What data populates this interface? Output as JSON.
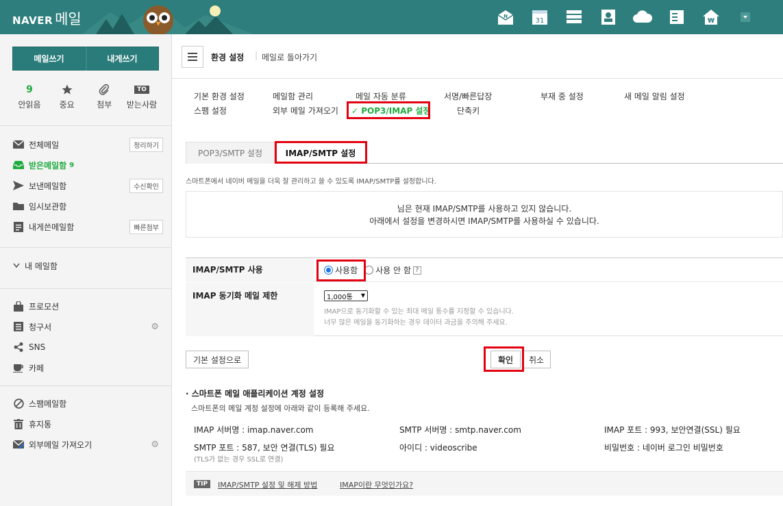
{
  "header": {
    "brand": "NAVER",
    "product": "메일",
    "icons": [
      {
        "name": "mail-envelope-icon",
        "label": "N"
      },
      {
        "name": "calendar-icon",
        "label": "31"
      },
      {
        "name": "list-icon",
        "label": ""
      },
      {
        "name": "contacts-icon",
        "label": ""
      },
      {
        "name": "cloud-icon",
        "label": ""
      },
      {
        "name": "memo-icon",
        "label": ""
      },
      {
        "name": "household-account-icon",
        "label": "₩"
      },
      {
        "name": "more-dropdown-icon",
        "label": "▾"
      }
    ]
  },
  "sidebar": {
    "write_btn": "메일쓰기",
    "self_btn": "내게쓰기",
    "quick": [
      {
        "count": "9",
        "label": "안읽음"
      },
      {
        "label": "중요"
      },
      {
        "label": "첨부"
      },
      {
        "badge": "TO",
        "label": "받는사람"
      }
    ],
    "mailboxes": [
      {
        "label": "전체메일",
        "action": "정리하기"
      },
      {
        "label": "받은메일함",
        "count": "9"
      },
      {
        "label": "보낸메일함",
        "action": "수신확인"
      },
      {
        "label": "임시보관함"
      },
      {
        "label": "내게쓴메일함",
        "action": "빠른첨부"
      }
    ],
    "my_mailbox": "내 메일함",
    "categories": [
      "프로모션",
      "청구서",
      "SNS",
      "카페"
    ],
    "system": [
      "스팸메일함",
      "휴지통",
      "외부메일 가져오기"
    ]
  },
  "topbar": {
    "title": "환경 설정",
    "back": "메일로 돌아가기"
  },
  "settings_nav": [
    "기본 환경 설정",
    "메일함 관리",
    "메일 자동 분류",
    "서명/빠른답장",
    "부재 중 설정",
    "새 메일 알림 설정",
    "스팸 설정",
    "외부 메일 가져오기",
    "✓ POP3/IMAP 설정",
    "단축키"
  ],
  "tabs": {
    "pop3": "POP3/SMTP 설정",
    "imap": "IMAP/SMTP 설정"
  },
  "description": "스마트폰에서 네이버 메일을 더욱 잘 관리하고 쓸 수 있도록 IMAP/SMTP를 설정합니다.",
  "notice": {
    "line1": "님은 현재 IMAP/SMTP를 사용하고 있지 않습니다.",
    "line2": "아래에서 설정을 변경하시면 IMAP/SMTP를 사용하실 수 있습니다."
  },
  "form": {
    "use_label": "IMAP/SMTP 사용",
    "use_on": "사용함",
    "use_off": "사용 안 함",
    "help": "?",
    "sync_label": "IMAP 동기화 메일 제한",
    "sync_value": "1,000통",
    "sync_help1": "IMAP으로 동기화할 수 있는 최대 메일 통수를 지정할 수 있습니다.",
    "sync_help2": "너무 많은 메일을 동기화하는 경우 데이터 과금을 주의해 주세요."
  },
  "buttons": {
    "reset": "기본 설정으로",
    "confirm": "확인",
    "cancel": "취소"
  },
  "smartphone": {
    "title": "· 스마트폰 메일 애플리케이션 계정 설정",
    "subtitle": "스마트폰의 메일 계정 설정에 아래와 같이 등록해 주세요.",
    "imap_server": "IMAP 서버명 : imap.naver.com",
    "smtp_server": "SMTP 서버명 : smtp.naver.com",
    "imap_port": "IMAP 포트 : 993, 보안연결(SSL) 필요",
    "smtp_port": "SMTP 포트 : 587, 보안 연결(TLS) 필요",
    "smtp_port_note": "(TLS가 없는 경우 SSL로 연결)",
    "user_id": "아이디 : videoscribe",
    "password": "비밀번호 : 네이버 로그인 비밀번호"
  },
  "tip": {
    "badge": "TIP",
    "link1": "IMAP/SMTP 설정 및 해제 방법",
    "link2": "IMAP이란 무엇인가요?"
  }
}
